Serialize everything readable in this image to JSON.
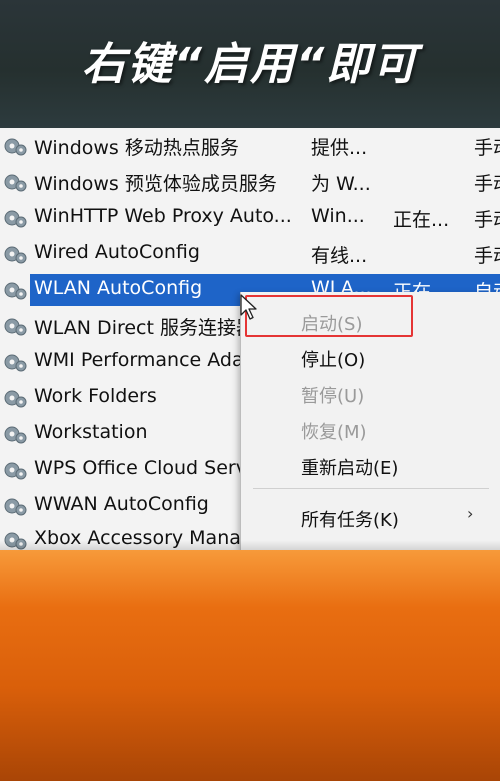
{
  "banner": {
    "text": "右键“启用“即可"
  },
  "services": [
    {
      "name": "Windows 移动热点服务",
      "description": "提供...",
      "status": "",
      "startup": "手动"
    },
    {
      "name": "Windows 预览体验成员服务",
      "description": "为 W...",
      "status": "",
      "startup": "手动"
    },
    {
      "name": "WinHTTP Web Proxy Auto...",
      "description": "Win...",
      "status": "正在...",
      "startup": "手动"
    },
    {
      "name": "Wired AutoConfig",
      "description": "有线...",
      "status": "",
      "startup": "手动"
    },
    {
      "name": "WLAN AutoConfig",
      "description": "WLA...",
      "status": "正在...",
      "startup": "自动"
    },
    {
      "name": "WLAN Direct 服务连接器",
      "description": "",
      "status": "",
      "startup": ""
    },
    {
      "name": "WMI Performance Adapter",
      "description": "",
      "status": "",
      "startup": ""
    },
    {
      "name": "Work Folders",
      "description": "",
      "status": "",
      "startup": ""
    },
    {
      "name": "Workstation",
      "description": "",
      "status": "",
      "startup": ""
    },
    {
      "name": "WPS Office Cloud Service",
      "description": "",
      "status": "",
      "startup": ""
    },
    {
      "name": "WWAN AutoConfig",
      "description": "",
      "status": "",
      "startup": ""
    },
    {
      "name": "Xbox Accessory Management Service",
      "description": "",
      "status": "",
      "startup": ""
    }
  ],
  "selected_service": "WLAN AutoConfig",
  "context_menu": {
    "items": [
      {
        "label": "启动(S)",
        "disabled": true
      },
      {
        "label": "停止(O)",
        "disabled": false
      },
      {
        "label": "暂停(U)",
        "disabled": true
      },
      {
        "label": "恢复(M)",
        "disabled": true
      },
      {
        "label": "重新启动(E)",
        "disabled": false
      },
      {
        "label": "所有任务(K)",
        "disabled": false,
        "submenu_arrow": "›"
      }
    ]
  },
  "icons": {
    "service": "gear-icon",
    "cursor": "mouse-pointer-icon"
  },
  "colors": {
    "selection": "#1e64c8",
    "highlight_box": "#e53535",
    "top_band": "#2b3539",
    "bottom_band": "#e96e11"
  }
}
